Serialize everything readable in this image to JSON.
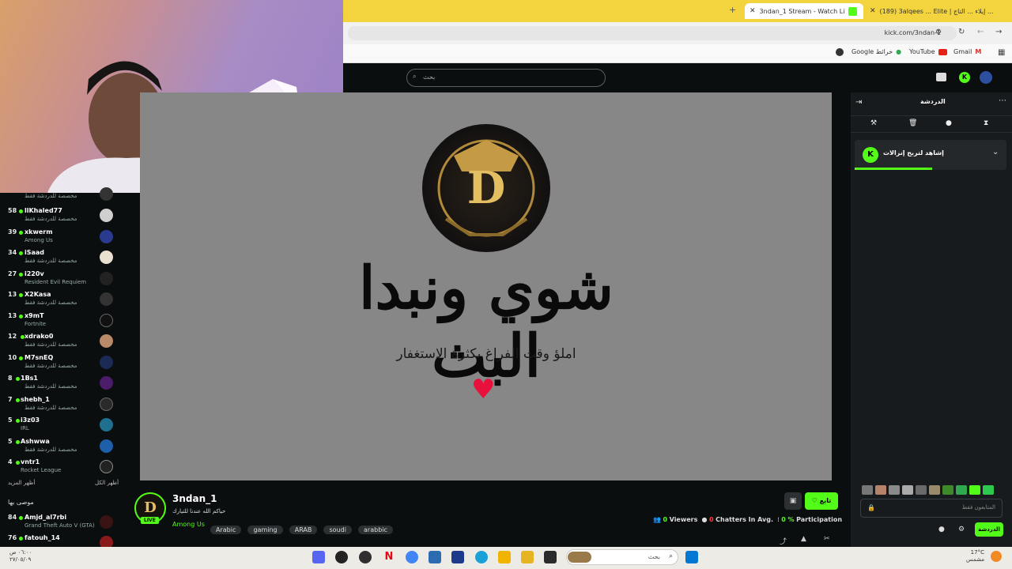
{
  "browser": {
    "tabs": [
      {
        "label": "3ndan_1 Stream - Watch Li"
      },
      {
        "label": "(189) 3alqees ... Elite | إيلاء ... التاج ..."
      }
    ],
    "url": "kick.com/3ndan-1",
    "bookmarks": [
      "Google خرائط",
      "YouTube",
      "Gmail"
    ]
  },
  "topnav": {
    "search_placeholder": "بحث"
  },
  "sidebar": {
    "first_row_category": "مخصصة للدردشة فقط",
    "channels": [
      {
        "viewers": "58",
        "name": "llKhaled77",
        "category": "مخصصة للدردشة فقط",
        "color": "#cfcfcf"
      },
      {
        "viewers": "39",
        "name": "xkwerm",
        "category": "Among Us",
        "color": "#2a3b8f"
      },
      {
        "viewers": "34",
        "name": "iSaad",
        "category": "مخصصة للدردشة فقط",
        "color": "#e9e0d0"
      },
      {
        "viewers": "27",
        "name": "i220v",
        "category": "Resident Evil Requiem",
        "color": "#222"
      },
      {
        "viewers": "13",
        "name": "X2Kasa",
        "category": "مخصصة للدردشة فقط",
        "color": "#333"
      },
      {
        "viewers": "13",
        "name": "x9mT",
        "category": "Fortnite",
        "color": "#111"
      },
      {
        "viewers": "12",
        "name": "xdrako0",
        "category": "مخصصة للدردشة فقط",
        "color": "#b98a6a"
      },
      {
        "viewers": "10",
        "name": "M7snEQ",
        "category": "مخصصة للدردشة فقط",
        "color": "#1b2a55"
      },
      {
        "viewers": "8",
        "name": "1Bs1",
        "category": "مخصصة للدردشة فقط",
        "color": "#4b1c6a"
      },
      {
        "viewers": "7",
        "name": "shebh_1",
        "category": "مخصصة للدردشة فقط",
        "color": "#2a2a2a"
      },
      {
        "viewers": "5",
        "name": "i3z03",
        "category": "IRL",
        "color": "#1f6f8f"
      },
      {
        "viewers": "5",
        "name": "Ashwwa",
        "category": "مخصصة للدردشة فقط",
        "color": "#1d5fa8"
      },
      {
        "viewers": "4",
        "name": "vntr1",
        "category": "Rocket League",
        "color": "#222"
      }
    ],
    "show_more": "أظهر المزيد",
    "show_all": "أظهر الكل",
    "recommended_title": "موصى بها",
    "recommended": [
      {
        "viewers": "84",
        "name": "Amjd_al7rbi",
        "category": "Grand Theft Auto V (GTA)",
        "color": "#3a1414"
      },
      {
        "viewers": "76",
        "name": "fatouh_14",
        "category": "",
        "color": "#8a1a1a"
      }
    ]
  },
  "player": {
    "title": "شوي ونبدا البث",
    "subtitle": "املؤ وقت الفراغ بكثرة الاستغفار",
    "logo_letter": "D"
  },
  "stream": {
    "channel_name": "3ndan_1",
    "live_badge": "LIVE",
    "stream_title": "حياكم الله عندنا للتيارك",
    "category": "Among Us",
    "tags": [
      "Arabic",
      "gaming",
      "ARAB",
      "soudi",
      "arabbic"
    ],
    "follow_label": "تابع",
    "viewers_value": "0",
    "viewers_label": "Viewers",
    "chatters_value": "0",
    "chatters_label": "Chatters In Avg.",
    "participation_value": "0 %",
    "participation_label": "Participation"
  },
  "chat": {
    "title": "الدردشة",
    "pinned_text": "إشاهد لتربح إنزالات",
    "followers_only": "المتابعون فقط",
    "send_label": "الدردشة"
  },
  "taskbar": {
    "search_placeholder": "بحث",
    "time": "٠٦:٠٠ ص",
    "date": "٢٧/٠٥/٠٩",
    "weather_temp": "17°C",
    "weather_desc": "مشمس"
  },
  "colors": {
    "accent": "#53fc18",
    "background": "#0b0e0f",
    "panel": "#181b1d",
    "tabbar": "#f3d43e"
  }
}
